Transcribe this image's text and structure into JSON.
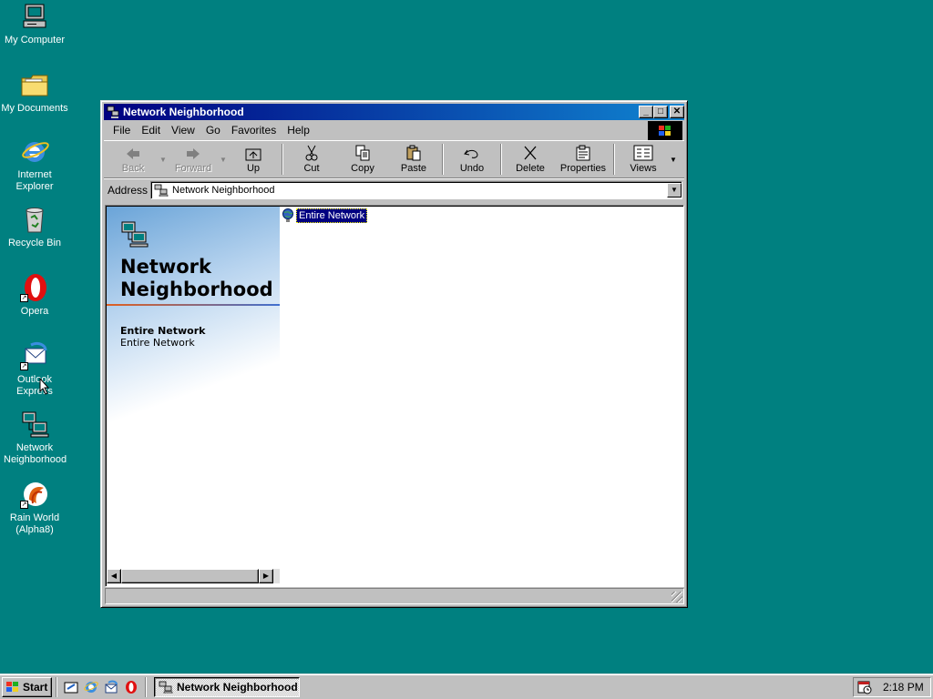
{
  "desktop": {
    "icons": [
      {
        "label": "My Computer",
        "icon": "computer-icon"
      },
      {
        "label": "My Documents",
        "icon": "folder-icon"
      },
      {
        "label": "Internet Explorer",
        "icon": "ie-icon"
      },
      {
        "label": "Recycle Bin",
        "icon": "recycle-bin-icon"
      },
      {
        "label": "Opera",
        "icon": "opera-icon"
      },
      {
        "label": "Outlook Express",
        "icon": "outlook-express-icon"
      },
      {
        "label": "Network Neighborhood",
        "icon": "network-icon"
      },
      {
        "label": "Rain World (Alpha8)",
        "icon": "rainworld-icon"
      }
    ]
  },
  "window": {
    "title": "Network Neighborhood",
    "menu": [
      "File",
      "Edit",
      "View",
      "Go",
      "Favorites",
      "Help"
    ],
    "toolbar": {
      "back": "Back",
      "forward": "Forward",
      "up": "Up",
      "cut": "Cut",
      "copy": "Copy",
      "paste": "Paste",
      "undo": "Undo",
      "delete": "Delete",
      "properties": "Properties",
      "views": "Views"
    },
    "address": {
      "label": "Address",
      "value": "Network Neighborhood"
    },
    "webview": {
      "heading": "Network Neighborhood",
      "selected_title": "Entire Network",
      "selected_desc": "Entire Network"
    },
    "items": [
      {
        "label": "Entire Network",
        "icon": "globe-icon",
        "selected": true
      }
    ]
  },
  "taskbar": {
    "start_label": "Start",
    "task_label": "Network Neighborhood",
    "clock": "2:18 PM"
  },
  "colors": {
    "desktop": "#008080",
    "title_active": "#000080",
    "face": "#c0c0c0"
  }
}
